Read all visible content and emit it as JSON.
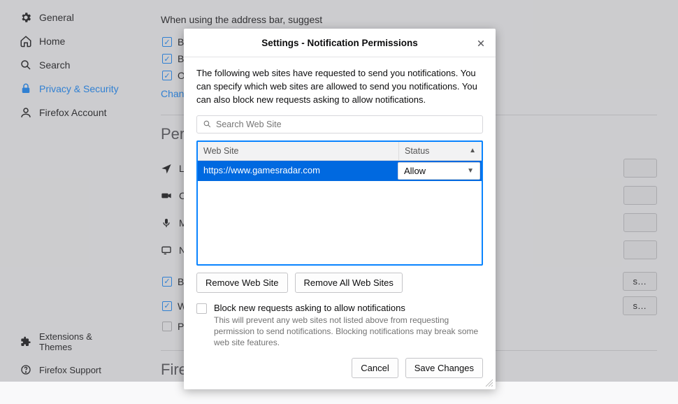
{
  "sidebar": {
    "items": [
      {
        "label": "General"
      },
      {
        "label": "Home"
      },
      {
        "label": "Search"
      },
      {
        "label": "Privacy & Security"
      },
      {
        "label": "Firefox Account"
      }
    ],
    "bottom": [
      {
        "label": "Extensions & Themes"
      },
      {
        "label": "Firefox Support"
      }
    ]
  },
  "main": {
    "address_intro": "When using the address bar, suggest",
    "cb_browsing": "Browsi",
    "cb_bookmarks": "Bookma",
    "cb_opentabs": "Open ta",
    "change_link": "Change pre",
    "permissions_title": "Permissi",
    "perm_location": "Location",
    "perm_camera": "Camera",
    "perm_microphone": "Microph",
    "perm_notification": "Notificat",
    "cb_block_popups": "Block po",
    "cb_warn": "Warn yo",
    "cb_prevent": "Prevent",
    "settings_btn_tail": "s…",
    "data_title": "Firefox Data Collection and Use"
  },
  "modal": {
    "title": "Settings - Notification Permissions",
    "description": "The following web sites have requested to send you notifications. You can specify which web sites are allowed to send you notifications. You can also block new requests asking to allow notifications.",
    "search_placeholder": "Search Web Site",
    "th_website": "Web Site",
    "th_status": "Status",
    "row_site": "https://www.gamesradar.com",
    "row_status": "Allow",
    "remove_site": "Remove Web Site",
    "remove_all": "Remove All Web Sites",
    "block_label": "Block new requests asking to allow notifications",
    "block_desc": "This will prevent any web sites not listed above from requesting permission to send notifications. Blocking notifications may break some web site features.",
    "cancel": "Cancel",
    "save": "Save Changes"
  }
}
